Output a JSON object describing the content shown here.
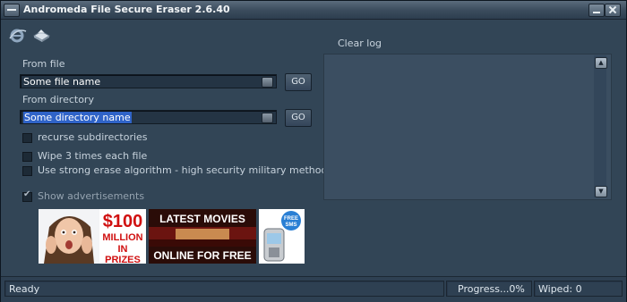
{
  "window": {
    "title": "Andromeda File Secure Eraser 2.6.40"
  },
  "toolbar": {
    "icons": [
      "ie-icon",
      "tray-icon"
    ]
  },
  "file_section": {
    "label": "From file",
    "value": "Some file name",
    "go_label": "GO"
  },
  "dir_section": {
    "label": "From directory",
    "value": "Some directory name",
    "go_label": "GO"
  },
  "options": {
    "recurse": {
      "label": "recurse subdirectories",
      "checked": false
    },
    "wipe3": {
      "label": "Wipe 3 times each file",
      "checked": false
    },
    "strong": {
      "label": "Use strong erase algorithm - high security military method",
      "checked": false
    },
    "show_ads": {
      "label": "Show advertisements",
      "checked": true
    }
  },
  "ads": {
    "ad1": {
      "line1": "$100",
      "line2": "MILLION",
      "line3": "IN PRIZES"
    },
    "ad2": {
      "line1": "LATEST MOVIES",
      "line2": "ONLINE FOR FREE"
    },
    "ad3": {
      "badge": "FREE SMS"
    }
  },
  "log": {
    "clear_label": "Clear log"
  },
  "status": {
    "state": "Ready",
    "progress": "Progress...0%",
    "wiped": "Wiped: 0"
  }
}
